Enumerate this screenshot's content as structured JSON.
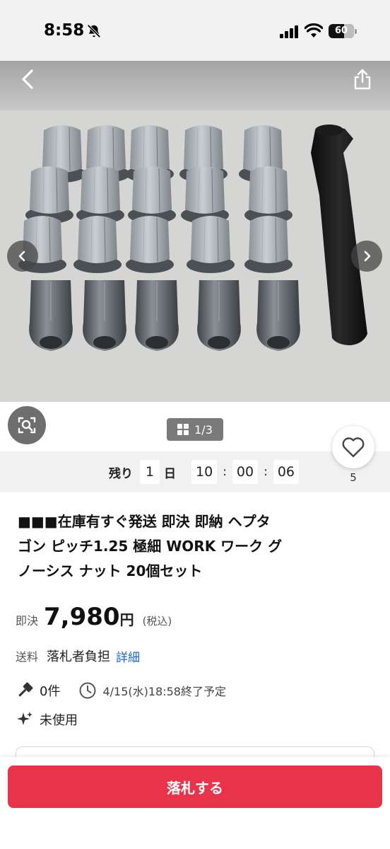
{
  "status_bar": {
    "time": "8:58",
    "battery": "60",
    "battery_level": 0.6
  },
  "gallery": {
    "counter": "1/3"
  },
  "countdown": {
    "prefix": "残り",
    "days": "1",
    "day_unit": "日",
    "hours": "10",
    "minutes": "00",
    "seconds": "06",
    "separator": ":"
  },
  "favorite": {
    "count": "5"
  },
  "item": {
    "title_line1": "■■■在庫有すぐ発送 即決 即納 ヘプタ",
    "title_line2": "ゴン ピッチ1.25 極細 WORK ワーク グ",
    "title_line3": "ノーシス ナット 20個セット",
    "price_label": "即決",
    "price": "7,980",
    "price_unit": "円",
    "tax_note": "(税込)",
    "shipping_label": "送料",
    "shipping_value": "落札者負担",
    "shipping_link": "詳細",
    "bids": "0件",
    "end_time": "4/15(水)18:58終了予定",
    "condition": "未使用"
  },
  "actions": {
    "bid_button": "落札する"
  },
  "colors": {
    "accent": "#e8334a",
    "link": "#1a66c9"
  },
  "icons": [
    "bell-off-icon",
    "signal-icon",
    "wifi-icon",
    "battery-icon",
    "back-icon",
    "share-icon",
    "chevron-left-icon",
    "chevron-right-icon",
    "image-search-icon",
    "grid-icon",
    "heart-icon",
    "gavel-icon",
    "clock-icon",
    "sparkle-icon"
  ]
}
